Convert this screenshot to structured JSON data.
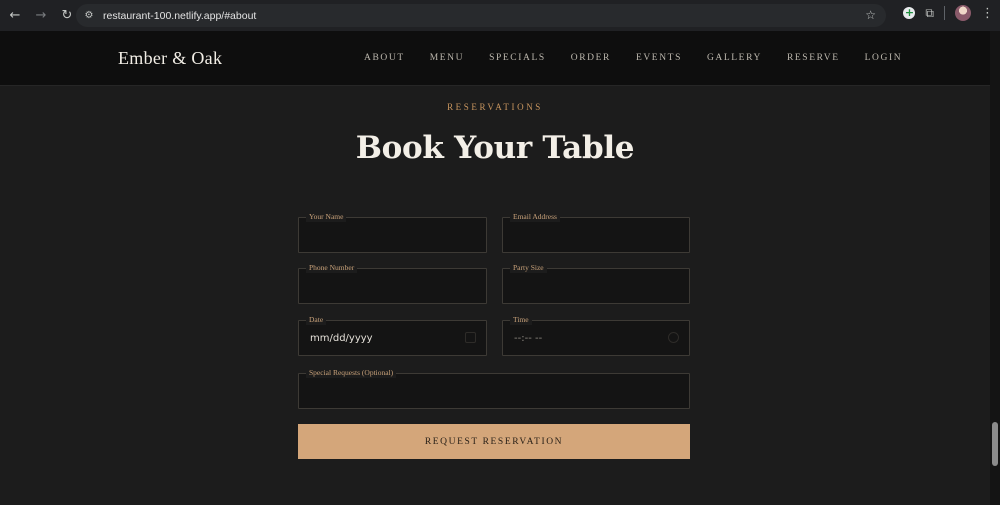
{
  "browser": {
    "url": "restaurant-100.netlify.app/#about"
  },
  "site": {
    "logo": "Ember & Oak",
    "nav": [
      "ABOUT",
      "MENU",
      "SPECIALS",
      "ORDER",
      "EVENTS",
      "GALLERY",
      "RESERVE",
      "LOGIN"
    ]
  },
  "reservation": {
    "eyebrow": "RESERVATIONS",
    "title": "Book Your Table",
    "fields": {
      "name": {
        "label": "Your Name",
        "value": ""
      },
      "email": {
        "label": "Email Address",
        "value": ""
      },
      "phone": {
        "label": "Phone Number",
        "value": ""
      },
      "party": {
        "label": "Party Size",
        "value": ""
      },
      "date": {
        "label": "Date",
        "value": "mm/dd/yyyy"
      },
      "time": {
        "label": "Time",
        "value": "--:-- --"
      },
      "notes": {
        "label": "Special Requests (Optional)",
        "value": ""
      }
    },
    "submit_label": "REQUEST RESERVATION"
  },
  "colors": {
    "accent": "#d4a67a",
    "eyebrow": "#c9965f",
    "background": "#1c1c1c",
    "header": "#0e0e0e"
  }
}
